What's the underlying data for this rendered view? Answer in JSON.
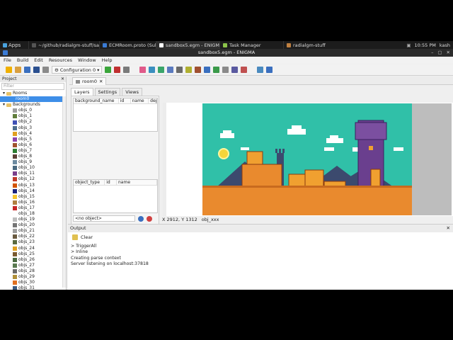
{
  "taskbar": {
    "apps_label": "Apps",
    "tasks": [
      {
        "label": "~/github/radialgm-stuff/sa...",
        "color": "#4a4a4a"
      },
      {
        "label": "ECMRoom.proto (Submod...",
        "color": "#3a7bd5"
      },
      {
        "label": "sandbox5.egm - ENIGMA",
        "color": "#ffffff",
        "active": true
      },
      {
        "label": "Task Manager",
        "color": "#8bc34a"
      },
      {
        "label": "radialgm-stuff",
        "color": "#c08040"
      }
    ],
    "clock": "10:55 PM",
    "user": "kash"
  },
  "window": {
    "title": "sandbox5.egm - ENIGMA"
  },
  "menu": [
    "File",
    "Build",
    "Edit",
    "Resources",
    "Window",
    "Help"
  ],
  "toolbar": {
    "configuration": "Configuration 0"
  },
  "project": {
    "header": "Project",
    "filter_placeholder": "Filter",
    "rooms_label": "Rooms",
    "room_item": "room0",
    "backgrounds_label": "Backgrounds",
    "items": [
      {
        "label": "objs_0",
        "color": "#9e9e9e"
      },
      {
        "label": "objs_1",
        "color": "#607d3b"
      },
      {
        "label": "objs_2",
        "color": "#3f51b5"
      },
      {
        "label": "objs_3",
        "color": "#4e6e8e"
      },
      {
        "label": "objs_4",
        "color": "#e0a020"
      },
      {
        "label": "objs_5",
        "color": "#8e44ad"
      },
      {
        "label": "objs_6",
        "color": "#a0522d"
      },
      {
        "label": "objs_7",
        "color": "#2e7d32"
      },
      {
        "label": "objs_8",
        "color": "#5d4037"
      },
      {
        "label": "objs_9",
        "color": "#6d8ba0"
      },
      {
        "label": "objs_10",
        "color": "#4a6a80"
      },
      {
        "label": "objs_11",
        "color": "#7b3f8c"
      },
      {
        "label": "objs_12",
        "color": "#c0392b"
      },
      {
        "label": "objs_13",
        "color": "#d35400"
      },
      {
        "label": "objs_14",
        "color": "#1a237e"
      },
      {
        "label": "objs_15",
        "color": "#f4c430"
      },
      {
        "label": "objs_16",
        "color": "#b08040"
      },
      {
        "label": "objs_17",
        "color": "#c62828"
      },
      {
        "label": "objs_18",
        "color": "#ffffff"
      },
      {
        "label": "objs_19",
        "color": "#bdbdbd"
      },
      {
        "label": "objs_20",
        "color": "#757575"
      },
      {
        "label": "objs_21",
        "color": "#9e9e9e"
      },
      {
        "label": "objs_22",
        "color": "#6a5a40"
      },
      {
        "label": "objs_23",
        "color": "#5a6a40"
      },
      {
        "label": "objs_24",
        "color": "#e0a020"
      },
      {
        "label": "objs_25",
        "color": "#7a5a30"
      },
      {
        "label": "objs_26",
        "color": "#4a6a40"
      },
      {
        "label": "objs_27",
        "color": "#5a7a50"
      },
      {
        "label": "objs_28",
        "color": "#6a6a6a"
      },
      {
        "label": "objs_29",
        "color": "#b0903a"
      },
      {
        "label": "objs_30",
        "color": "#e07020"
      },
      {
        "label": "objs_31",
        "color": "#3a5a80"
      }
    ]
  },
  "room_editor": {
    "tab_label": "room0",
    "subtabs": [
      "Layers",
      "Settings",
      "Views"
    ],
    "bg_headers": [
      "background_name",
      "id",
      "name",
      "dep"
    ],
    "obj_headers": [
      "object_type",
      "id",
      "name"
    ],
    "no_object": "<no object>",
    "status_coords": "X 2912, Y 1312",
    "status_obj": "obj_xxx"
  },
  "output": {
    "header": "Output",
    "clear_label": "Clear",
    "lines": [
      "> TriggerAll",
      "> Inline",
      "",
      "Creating parse context",
      "",
      "Server listening on localhost:37818"
    ]
  },
  "colors": {
    "accent": "#3d8ee8",
    "sky": "#30c0a8",
    "ground": "#e98a2e"
  }
}
